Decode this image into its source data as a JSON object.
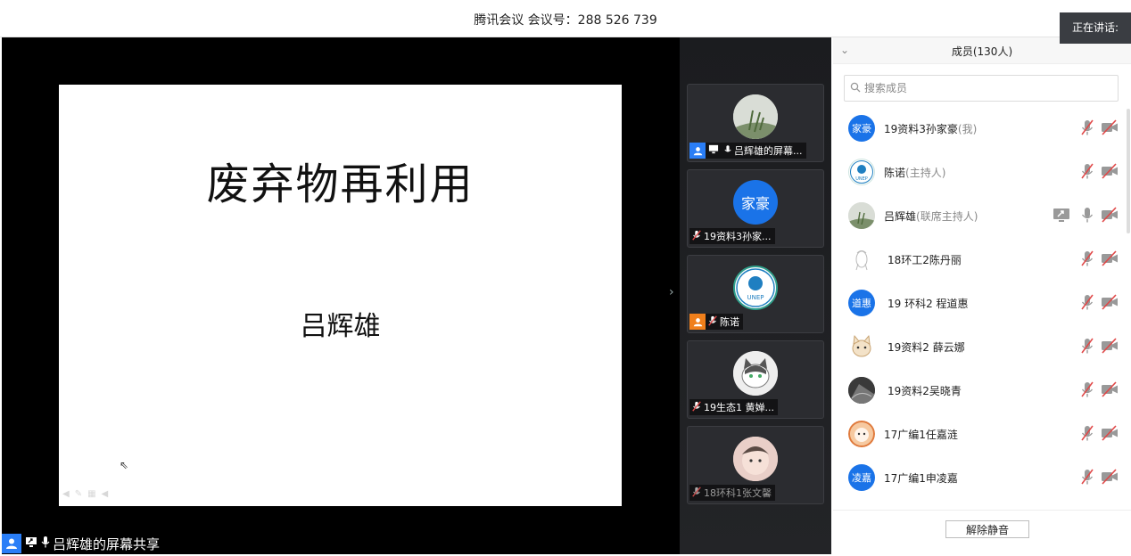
{
  "window": {
    "title": "腾讯会议 会议号：288 526 739"
  },
  "speaking_label": "正在讲话:",
  "slide": {
    "title": "废弃物再利用",
    "author": "吕辉雄"
  },
  "share_bar": {
    "label": "吕辉雄的屏幕共享"
  },
  "gallery": {
    "tiles": [
      {
        "label": "吕辉雄的屏幕...",
        "avatar": "landscape-photo",
        "host": true
      },
      {
        "label": "19资料3孙家...",
        "avatar_text": "家豪",
        "muted": true
      },
      {
        "label": "陈诺",
        "avatar": "unep-logo",
        "host": true,
        "muted": true
      },
      {
        "label": "19生态1 黄婵...",
        "avatar": "cat-photo",
        "muted": true
      },
      {
        "label": "18环科1张文馨",
        "avatar": "baby-photo",
        "muted": true
      }
    ]
  },
  "panel": {
    "title": "成员(130人)",
    "search_placeholder": "搜索成员",
    "members": [
      {
        "name": "19资料3孙家豪",
        "role": "(我)",
        "avatar_text": "家豪",
        "avatar_color": "#1a73e8",
        "mic_muted": true,
        "cam_off": true
      },
      {
        "name": "陈诺",
        "role": "(主持人)",
        "avatar": "unep-logo",
        "mic_muted": true,
        "cam_off": true
      },
      {
        "name": "吕辉雄",
        "role": "(联席主持人)",
        "avatar": "landscape-photo",
        "sharing": true,
        "mic_muted": false,
        "cam_off": true
      },
      {
        "name": "18环工2陈丹丽",
        "role": "",
        "avatar": "sketch-photo",
        "mic_muted": true,
        "cam_off": true
      },
      {
        "name": "19 环科2 程道惠",
        "role": "",
        "avatar_text": "道惠",
        "avatar_color": "#1a73e8",
        "mic_muted": true,
        "cam_off": true
      },
      {
        "name": "19资料2 薛云娜",
        "role": "",
        "avatar": "cat-cartoon",
        "mic_muted": true,
        "cam_off": true
      },
      {
        "name": "19资料2吴晓青",
        "role": "",
        "avatar": "dark-photo",
        "mic_muted": true,
        "cam_off": true
      },
      {
        "name": "17广编1任嘉涟",
        "role": "",
        "avatar": "cartoon-photo",
        "mic_muted": true,
        "cam_off": true
      },
      {
        "name": "17广编1申凌嘉",
        "role": "",
        "avatar_text": "凌嘉",
        "avatar_color": "#1a73e8",
        "mic_muted": true,
        "cam_off": true
      }
    ],
    "unmute_all_label": "解除静音"
  },
  "colors": {
    "accent": "#1a73e8",
    "muted_red": "#e04848",
    "host_badge": "#f07f1b",
    "stage_bg": "#000000"
  }
}
